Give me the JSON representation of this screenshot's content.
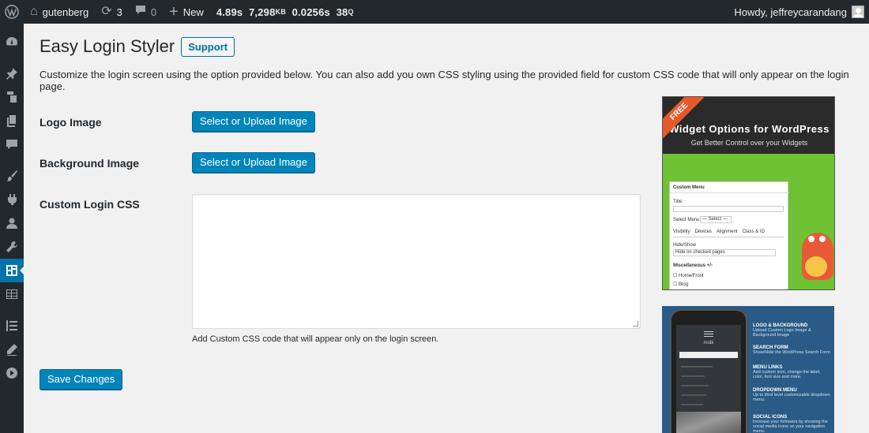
{
  "adminbar": {
    "site_name": "gutenberg",
    "updates_count": "3",
    "comments_count": "0",
    "new_label": "New",
    "stat1": "4.89s",
    "stat2_value": "7,298",
    "stat2_unit": "KB",
    "stat3": "0.0256s",
    "stat4_value": "38",
    "stat4_unit": "Q",
    "greeting": "Howdy, jeffreycarandang"
  },
  "page": {
    "title": "Easy Login Styler",
    "support_label": "Support",
    "description": "Customize the login screen using the option provided below. You can also add you own CSS styling using the provided field for custom CSS code that will only appear on the login page."
  },
  "form": {
    "logo_label": "Logo Image",
    "logo_button": "Select or Upload Image",
    "background_label": "Background Image",
    "background_button": "Select or Upload Image",
    "css_label": "Custom Login CSS",
    "css_value": "",
    "css_help": "Add Custom CSS code that will appear only on the login screen.",
    "save_label": "Save Changes"
  },
  "ads": {
    "widget_ribbon": "FREE",
    "widget_title": "Widget Options for WordPress",
    "widget_subtitle": "Get Better Control over your Widgets",
    "widget_panel": {
      "header": "Custom Menu",
      "title_label": "Title:",
      "select_menu": "Select Menu:",
      "select_value": "— Select —",
      "tabs": [
        "Visibility",
        "Devices",
        "Alignment",
        "Class & ID"
      ],
      "hide_show": "Hide/Show",
      "hide_value": "Hide on checked pages",
      "misc": "Miscellaneous +/-",
      "item1": "Home/Front",
      "item2": "Blog"
    },
    "mobi": {
      "brand": "mobi",
      "features": [
        {
          "title": "LOGO & BACKGROUND",
          "desc": "Upload Custom Logo Image & Background Image"
        },
        {
          "title": "SEARCH FORM",
          "desc": "Show/Hide the WordPress Search Form"
        },
        {
          "title": "MENU LINKS",
          "desc": "Add custom icon, change the label, color, font size and more."
        },
        {
          "title": "DROPDOWN MENU",
          "desc": "Up to third level customizable dropdown menu."
        },
        {
          "title": "SOCIAL ICONS",
          "desc": "Increase your followers by showing the social media icons on your navigation menu."
        }
      ]
    }
  },
  "colors": {
    "primary": "#0085ba",
    "adminbar_bg": "#23282d",
    "active_menu": "#0073aa",
    "ad_green": "#6ec233",
    "ad_blue": "#2a5b86"
  }
}
